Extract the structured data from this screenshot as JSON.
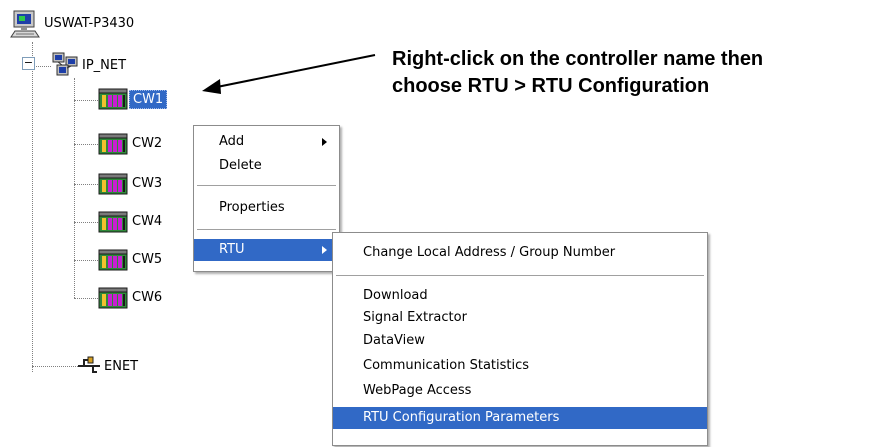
{
  "tree": {
    "root": "USWAT-P3430",
    "network": "IP_NET",
    "controllers": [
      "CW1",
      "CW2",
      "CW3",
      "CW4",
      "CW5",
      "CW6"
    ],
    "enet": "ENET",
    "expander_symbol": "−"
  },
  "context_menu": {
    "items": [
      "Add",
      "Delete",
      "Properties",
      "RTU"
    ]
  },
  "rtu_submenu": {
    "items": [
      "Change Local Address / Group Number",
      "Download",
      "Signal Extractor",
      "DataView",
      "Communication Statistics",
      "WebPage Access",
      "RTU Configuration Parameters"
    ]
  },
  "callout": {
    "line1": "Right-click on the controller name then",
    "line2": "choose RTU > RTU Configuration"
  },
  "colors": {
    "selection": "#3169c6",
    "plc_green": "#2f8a3a",
    "plc_magenta": "#c81ed2"
  }
}
